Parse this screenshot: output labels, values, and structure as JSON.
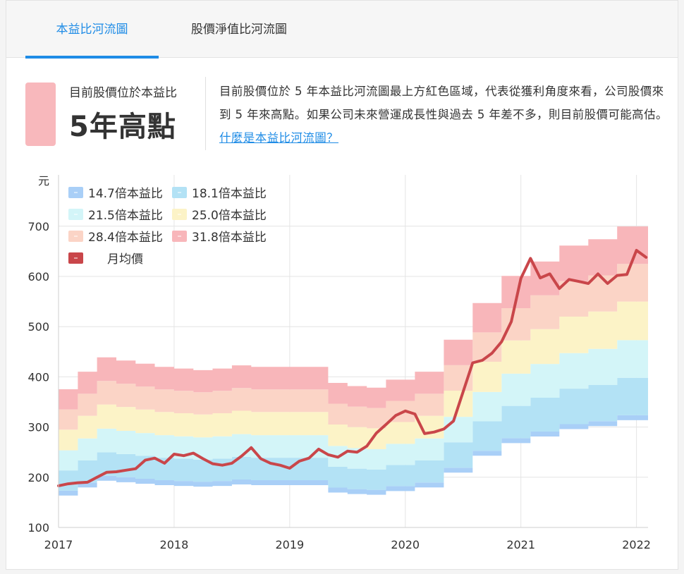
{
  "tabs": [
    {
      "label": "本益比河流圖",
      "active": true
    },
    {
      "label": "股價淨值比河流圖",
      "active": false
    }
  ],
  "status": {
    "label": "目前股價位於本益比",
    "value": "5年高點",
    "color": "#f8b8bc"
  },
  "description": {
    "text": "目前股價位於 5 年本益比河流圖最上方紅色區域，代表從獲利角度來看，公司股價來到 5 年來高點。如果公司未來營運成長性與過去 5 年差不多，則目前股價可能高估。",
    "link_label": "什麼是本益比河流圖？"
  },
  "chart_data": {
    "type": "area",
    "ylabel": "元",
    "ylim": [
      100,
      740
    ],
    "yticks": [
      100,
      200,
      300,
      400,
      500,
      600,
      700
    ],
    "xticks": [
      "2017",
      "2018",
      "2019",
      "2020",
      "2021",
      "2022"
    ],
    "xlim": [
      2017.0,
      2022.1
    ],
    "grid": true,
    "legend": "top-left",
    "x": [
      2017.0,
      2017.083,
      2017.167,
      2017.25,
      2017.333,
      2017.417,
      2017.5,
      2017.583,
      2017.667,
      2017.75,
      2017.833,
      2017.917,
      2018.0,
      2018.083,
      2018.167,
      2018.25,
      2018.333,
      2018.417,
      2018.5,
      2018.583,
      2018.667,
      2018.75,
      2018.833,
      2018.917,
      2019.0,
      2019.083,
      2019.167,
      2019.25,
      2019.333,
      2019.417,
      2019.5,
      2019.583,
      2019.667,
      2019.75,
      2019.833,
      2019.917,
      2020.0,
      2020.083,
      2020.167,
      2020.25,
      2020.333,
      2020.417,
      2020.5,
      2020.583,
      2020.667,
      2020.75,
      2020.833,
      2020.917,
      2021.0,
      2021.083,
      2021.167,
      2021.25,
      2021.333,
      2021.417,
      2021.5,
      2021.583,
      2021.667,
      2021.75,
      2021.833,
      2021.917,
      2022.0,
      2022.083
    ],
    "eps": [
      11.8,
      11.8,
      12.9,
      12.9,
      13.8,
      13.8,
      13.6,
      13.6,
      13.4,
      13.4,
      13.2,
      13.2,
      13.1,
      13.1,
      13.0,
      13.0,
      13.1,
      13.1,
      13.3,
      13.3,
      13.2,
      13.2,
      13.2,
      13.2,
      13.2,
      13.2,
      13.2,
      13.2,
      12.2,
      12.2,
      12.0,
      12.0,
      11.9,
      11.9,
      12.4,
      12.4,
      12.4,
      12.9,
      12.9,
      12.9,
      14.9,
      14.9,
      14.9,
      17.2,
      17.2,
      17.2,
      18.9,
      18.9,
      18.9,
      19.8,
      19.8,
      19.8,
      20.8,
      20.8,
      20.8,
      21.2,
      21.2,
      21.2,
      22.0,
      22.0,
      22.0,
      22.0
    ],
    "bands": [
      {
        "name": "14.7倍本益比",
        "multiple": 14.7,
        "color": "#a9cff7"
      },
      {
        "name": "18.1倍本益比",
        "multiple": 18.1,
        "color": "#b3e2f5"
      },
      {
        "name": "21.5倍本益比",
        "multiple": 21.5,
        "color": "#d3f5f8"
      },
      {
        "name": "25.0倍本益比",
        "multiple": 25.0,
        "color": "#fcf3c7"
      },
      {
        "name": "28.4倍本益比",
        "multiple": 28.4,
        "color": "#fbd4c6"
      },
      {
        "name": "31.8倍本益比",
        "multiple": 31.8,
        "color": "#f8b6ba"
      }
    ],
    "price_series": {
      "name": "月均價",
      "color": "#c9464a",
      "values": [
        183,
        187,
        189,
        190,
        200,
        210,
        211,
        214,
        217,
        234,
        238,
        228,
        246,
        243,
        248,
        237,
        227,
        224,
        228,
        242,
        259,
        237,
        228,
        224,
        218,
        232,
        238,
        256,
        245,
        240,
        252,
        250,
        262,
        288,
        305,
        323,
        332,
        326,
        287,
        290,
        296,
        312,
        370,
        428,
        433,
        447,
        470,
        510,
        596,
        636,
        597,
        605,
        576,
        594,
        590,
        586,
        605,
        586,
        602,
        604,
        652,
        638
      ]
    }
  }
}
